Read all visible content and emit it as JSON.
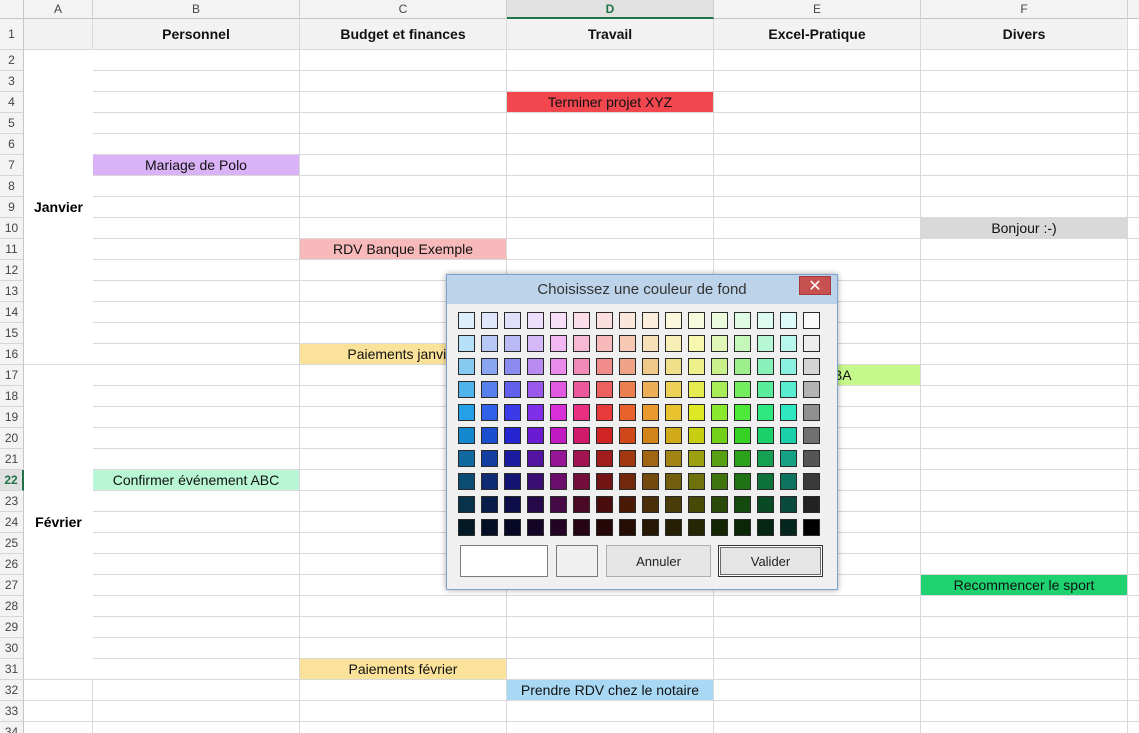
{
  "columns": [
    "A",
    "B",
    "C",
    "D",
    "E",
    "F"
  ],
  "selected_column": "D",
  "selected_row": 22,
  "headers": [
    "Personnel",
    "Budget et finances",
    "Travail",
    "Excel-Pratique",
    "Divers"
  ],
  "months": [
    "Janvier",
    "Février"
  ],
  "events": [
    {
      "text": "Terminer projet XYZ",
      "col": "D",
      "row": 4,
      "color": "#f2474f"
    },
    {
      "text": "Mariage de Polo",
      "col": "B",
      "row": 7,
      "color": "#d9b2f7"
    },
    {
      "text": "Bonjour :-)",
      "col": "F",
      "row": 10,
      "color": "#d9d9d9"
    },
    {
      "text": "RDV Banque Exemple",
      "col": "C",
      "row": 11,
      "color": "#f7b9b9"
    },
    {
      "text": "Paiements janvier",
      "col": "C",
      "row": 16,
      "color": "#fbe29a"
    },
    {
      "text": "Cours VBA",
      "col": "E",
      "row": 17,
      "color": "#c6f98b"
    },
    {
      "text": "Confirmer événement ABC",
      "col": "B",
      "row": 22,
      "color": "#b9f7d4"
    },
    {
      "text": "Recommencer le sport",
      "col": "F",
      "row": 27,
      "color": "#1ed36f"
    },
    {
      "text": "Paiements février",
      "col": "C",
      "row": 31,
      "color": "#fbe29a"
    },
    {
      "text": "Prendre RDV chez le notaire",
      "col": "D",
      "row": 32,
      "color": "#a8d8f3"
    }
  ],
  "dialog": {
    "title": "Choisissez une couleur de fond",
    "close_symbol": "✕",
    "cancel_label": "Annuler",
    "ok_label": "Valider",
    "palette": [
      [
        "#dceefb",
        "#dfe6fb",
        "#e0e0fb",
        "#ebdffb",
        "#f8dff8",
        "#fbdde9",
        "#fbdfdf",
        "#fbe6dc",
        "#fbeedd",
        "#fbf7dd",
        "#f6fbdd",
        "#ebfbdd",
        "#dffbe3",
        "#ddfbee",
        "#ddfbf8",
        "#fafafa"
      ],
      [
        "#b5e0f7",
        "#b7c8f7",
        "#babaf7",
        "#d4b8f7",
        "#f2b8f2",
        "#f7b8d3",
        "#f7b9b9",
        "#f7c9b5",
        "#f7dfb8",
        "#f7eeb8",
        "#f7f7b0",
        "#e0f7b8",
        "#c6f7ba",
        "#b8f7d4",
        "#b8f7ee",
        "#ededed"
      ],
      [
        "#86caf0",
        "#8aa5f0",
        "#8c8cf0",
        "#b98af0",
        "#ea8aea",
        "#f08ab7",
        "#f08c8c",
        "#f0a386",
        "#f0c88a",
        "#f0e08a",
        "#eef08a",
        "#c9f08a",
        "#9ef08c",
        "#8af0b9",
        "#8af0e0",
        "#d4d4d4"
      ],
      [
        "#4fb3ec",
        "#5880ec",
        "#6060ec",
        "#9b58ec",
        "#e158e1",
        "#ec589c",
        "#ec6060",
        "#ec7f4f",
        "#ecaf58",
        "#ecd058",
        "#e6ec4f",
        "#a8ec58",
        "#74ec60",
        "#58ec9b",
        "#58ecd0",
        "#b3b3b3"
      ],
      [
        "#24a0e8",
        "#2f62e8",
        "#3a3ae8",
        "#7f2fe8",
        "#d92fd9",
        "#e82f82",
        "#e83a3a",
        "#e8602a",
        "#e89a2f",
        "#e8c22f",
        "#dfe824",
        "#8ae82f",
        "#4de83a",
        "#2fe87f",
        "#2fe8c2",
        "#909090"
      ],
      [
        "#1388cf",
        "#1a4fd0",
        "#2424d0",
        "#6a1ad0",
        "#c21ac2",
        "#d01a6b",
        "#d02424",
        "#d0481a",
        "#d0841a",
        "#d0aa1a",
        "#c8cf13",
        "#72d01a",
        "#37d024",
        "#1ad06a",
        "#1ad0aa",
        "#707070"
      ],
      [
        "#106aa0",
        "#143da1",
        "#1c1ca1",
        "#5214a1",
        "#961496",
        "#a11452",
        "#a11c1c",
        "#a13810",
        "#a16614",
        "#a18414",
        "#9b9f10",
        "#58a114",
        "#2ba11c",
        "#14a152",
        "#14a184",
        "#555555"
      ],
      [
        "#0b4c72",
        "#0e2c73",
        "#141473",
        "#3a0e73",
        "#6b0e6b",
        "#730e3a",
        "#731414",
        "#73280b",
        "#73490e",
        "#735e0e",
        "#6f720b",
        "#3f730e",
        "#1f7314",
        "#0e733a",
        "#0e735e",
        "#3a3a3a"
      ],
      [
        "#073249",
        "#091d4a",
        "#0d0d4a",
        "#25094a",
        "#450945",
        "#4a0925",
        "#4a0d0d",
        "#4a1a07",
        "#4a2f09",
        "#4a3c09",
        "#474907",
        "#294a09",
        "#144a0d",
        "#094a25",
        "#094a3c",
        "#222222"
      ],
      [
        "#031a26",
        "#040f26",
        "#070726",
        "#130426",
        "#240424",
        "#260413",
        "#260707",
        "#260d03",
        "#261804",
        "#261f04",
        "#252603",
        "#152604",
        "#0a2607",
        "#042613",
        "#04261f",
        "#000000"
      ]
    ]
  }
}
